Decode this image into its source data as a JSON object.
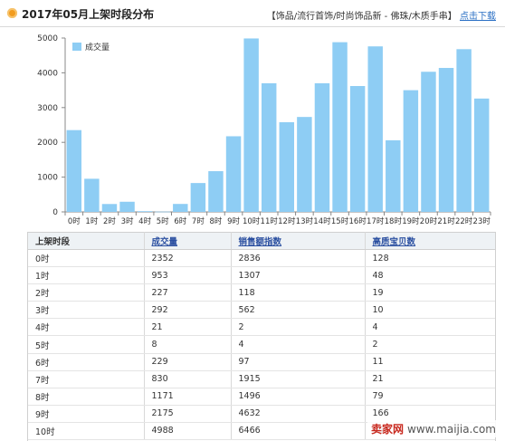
{
  "header": {
    "title": "2017年05月上架时段分布",
    "breadcrumb": "【饰品/流行首饰/时尚饰品新 - 佛珠/木质手串】",
    "download_label": "点击下载",
    "accent_color": "#f29c1f"
  },
  "chart_data": {
    "type": "bar",
    "categories": [
      "0时",
      "1时",
      "2时",
      "3时",
      "4时",
      "5时",
      "6时",
      "7时",
      "8时",
      "9时",
      "10时",
      "11时",
      "12时",
      "13时",
      "14时",
      "15时",
      "16时",
      "17时",
      "18时",
      "19时",
      "20时",
      "21时",
      "22时",
      "23时"
    ],
    "series": [
      {
        "name": "成交量",
        "color": "#8ecdf4",
        "values": [
          2352,
          953,
          227,
          292,
          21,
          8,
          229,
          830,
          1171,
          2175,
          4988,
          3700,
          2580,
          2730,
          3700,
          4880,
          3620,
          4760,
          2060,
          3500,
          4030,
          4140,
          4680,
          3260
        ]
      }
    ],
    "ylim": [
      0,
      5000
    ],
    "yticks": [
      0,
      1000,
      2000,
      3000,
      4000,
      5000
    ],
    "legend_position": "top-left",
    "grid": false
  },
  "table": {
    "headers": [
      "上架时段",
      "成交量",
      "销售额指数",
      "高质宝贝数"
    ],
    "rows": [
      [
        "0时",
        "2352",
        "2836",
        "128"
      ],
      [
        "1时",
        "953",
        "1307",
        "48"
      ],
      [
        "2时",
        "227",
        "118",
        "19"
      ],
      [
        "3时",
        "292",
        "562",
        "10"
      ],
      [
        "4时",
        "21",
        "2",
        "4"
      ],
      [
        "5时",
        "8",
        "4",
        "2"
      ],
      [
        "6时",
        "229",
        "97",
        "11"
      ],
      [
        "7时",
        "830",
        "1915",
        "21"
      ],
      [
        "8时",
        "1171",
        "1496",
        "79"
      ],
      [
        "9时",
        "2175",
        "4632",
        "166"
      ],
      [
        "10时",
        "4988",
        "6466",
        "169"
      ]
    ]
  },
  "watermark": {
    "brand": "卖家网",
    "site": "www.maijia.com"
  }
}
